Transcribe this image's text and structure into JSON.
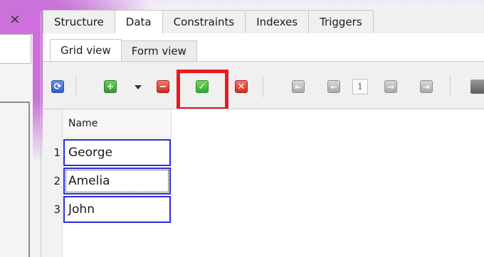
{
  "main_tabs": [
    "Structure",
    "Data",
    "Constraints",
    "Indexes",
    "Triggers"
  ],
  "active_main_tab": "Data",
  "sub_tabs": [
    "Grid view",
    "Form view"
  ],
  "active_sub_tab": "Grid view",
  "toolbar": {
    "icons": [
      "refresh-icon",
      "add-row-icon",
      "add-row-dropdown-icon",
      "delete-row-icon",
      "commit-icon",
      "rollback-icon",
      "first-page-icon",
      "previous-page-icon",
      "next-page-icon",
      "last-page-icon",
      "print-icon"
    ],
    "current_page": "1"
  },
  "grid": {
    "columns": [
      "Name"
    ],
    "rows": [
      {
        "num": "1",
        "name": "George"
      },
      {
        "num": "2",
        "name": "Amelia"
      },
      {
        "num": "3",
        "name": "John"
      }
    ]
  },
  "close_label": "×",
  "highlight_color": "#e8191f"
}
